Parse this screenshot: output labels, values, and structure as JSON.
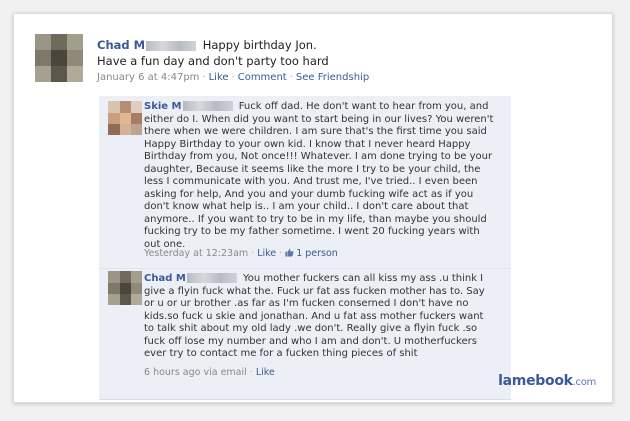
{
  "post": {
    "author": "Chad M",
    "text_line1": "Happy birthday Jon.",
    "text_line2": "Have a fun day and don't party too hard",
    "timestamp": "January 6 at 4:47pm",
    "like_label": "Like",
    "comment_label": "Comment",
    "see_friendship_label": "See Friendship"
  },
  "comments": [
    {
      "author": "Skie M",
      "text": "Fuck off dad. He don't want to hear from you, and either do I. When did you want to start being in our lives? You weren't there when we were children. I am sure that's the first time you said Happy Birthday to your own kid. I know that I never heard Happy Birthday from you, Not once!!! Whatever. I am done trying to be your daughter, Because it seems like the more I try to be your child, the less I communicate with you. And trust me, I've tried.. I even been asking for help, And you and your dumb fucking wife act as if you don't know what help is.. I am your child.. I don't care about that anymore.. If you want to try to be in my life, than maybe you should fucking try to be my father sometime. I went 20 fucking years with out one.",
      "timestamp": "Yesterday at 12:23am",
      "like_label": "Like",
      "likes_count": "1 person"
    },
    {
      "author": "Chad M",
      "text": "You mother fuckers can all kiss my ass .u think I give a flyin fuck what the. Fuck ur fat ass fucken mother has to. Say or u or ur brother .as far as I'm fucken conserned I don't have no kids.so fuck u skie and jonathan. And u fat ass mother fuckers want to talk shit about my old lady .we don't. Really give a flyin fuck .so fuck off lose my number and who I am and don't. U motherfuckers ever try to contact me for a fucken thing pieces of shit",
      "timestamp": "6 hours ago via email",
      "like_label": "Like"
    }
  ],
  "watermark": {
    "brand": "lamebook",
    "suffix": ".com"
  },
  "colors": {
    "link": "#3b5998",
    "comment_bg": "#eceff5",
    "meta_text": "#888888"
  },
  "icons": {
    "thumbs_up": "thumbs-up-icon"
  }
}
